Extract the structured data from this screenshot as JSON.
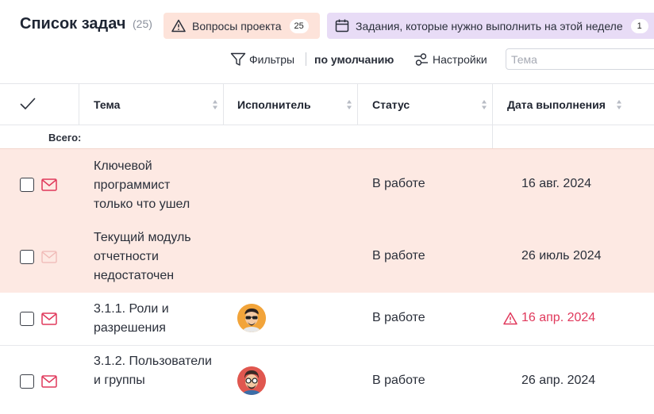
{
  "header": {
    "title": "Список задач",
    "count": "(25)"
  },
  "chips": {
    "project_questions": {
      "label": "Вопросы проекта",
      "count": "25",
      "icon": "warning-triangle-icon",
      "color": "#fde3da"
    },
    "this_week": {
      "label": "Задания, которые нужно выполнить на этой неделе",
      "count": "1",
      "icon": "calendar-icon",
      "color": "#e8dcf6"
    }
  },
  "toolbar": {
    "filters_label": "Фильтры",
    "preset_label": "по умолчанию",
    "settings_label": "Настройки",
    "search_placeholder": "Тема"
  },
  "table": {
    "columns": [
      "Тема",
      "Исполнитель",
      "Статус",
      "Дата выполнения"
    ],
    "total_label": "Всего:",
    "rows": [
      {
        "subject": "Ключевой программист только что ушел",
        "status": "В работе",
        "due": "16 авг. 2024",
        "assignee": "",
        "highlight": true,
        "overdue": false,
        "mail_active": true
      },
      {
        "subject": "Текущий модуль отчетности недостаточен",
        "status": "В работе",
        "due": "26 июль 2024",
        "assignee": "",
        "highlight": true,
        "overdue": false,
        "mail_active": false
      },
      {
        "subject": "3.1.1. Роли и разрешения",
        "status": "В работе",
        "due": "16 апр. 2024",
        "assignee": "avatar-sunglasses",
        "highlight": false,
        "overdue": true,
        "mail_active": true
      },
      {
        "subject": "3.1.2. Пользователи и группы",
        "status": "В работе",
        "due": "26 апр. 2024",
        "assignee": "avatar-glasses",
        "highlight": false,
        "overdue": false,
        "mail_active": true
      }
    ]
  },
  "colors": {
    "accent_red": "#e0385b",
    "highlight_row": "#fde9e3"
  }
}
